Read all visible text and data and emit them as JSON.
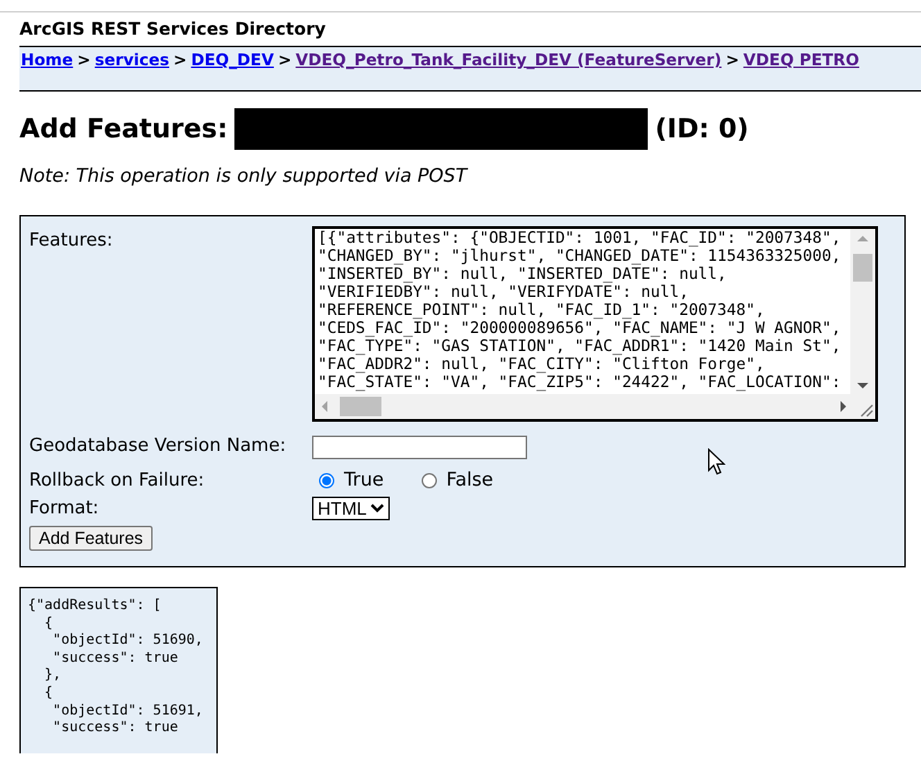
{
  "header": {
    "title": "ArcGIS REST Services Directory"
  },
  "breadcrumbs": [
    {
      "label": "Home",
      "visited": false
    },
    {
      "label": "services",
      "visited": false
    },
    {
      "label": "DEQ_DEV",
      "visited": false
    },
    {
      "label": "VDEQ_Petro_Tank_Facility_DEV (FeatureServer)",
      "visited": true
    },
    {
      "label": "VDEQ PETRO",
      "visited": true
    }
  ],
  "breadcrumb_separator": ">",
  "page_title": {
    "prefix": "Add Features:",
    "suffix": "(ID: 0)"
  },
  "note": "Note: This operation is only supported via POST",
  "form": {
    "features_label": "Features:",
    "features_lines": [
      "[{\"attributes\": {\"OBJECTID\": 1001, \"FAC_ID\": \"2007348\",",
      "\"CHANGED_BY\": \"jlhurst\", \"CHANGED_DATE\": 1154363325000,",
      "\"INSERTED_BY\": null, \"INSERTED_DATE\": null,",
      "\"VERIFIEDBY\": null, \"VERIFYDATE\": null,",
      "\"REFERENCE_POINT\": null, \"FAC_ID_1\": \"2007348\",",
      "\"CEDS_FAC_ID\": \"200000089656\", \"FAC_NAME\": \"J W AGNOR\",",
      "\"FAC_TYPE\": \"GAS STATION\", \"FAC_ADDR1\": \"1420 Main St\",",
      "\"FAC_ADDR2\": null, \"FAC_CITY\": \"Clifton Forge\",",
      "\"FAC_STATE\": \"VA\", \"FAC_ZIP5\": \"24422\", \"FAC_LOCATION\":"
    ],
    "version_label": "Geodatabase Version Name:",
    "rollback_label": "Rollback on Failure:",
    "rollback_options": [
      {
        "label": "True",
        "selected": true
      },
      {
        "label": "False",
        "selected": false
      }
    ],
    "format_label": "Format:",
    "format_value": "HTML",
    "submit": "Add Features"
  },
  "result_lines": [
    "{\"addResults\": [",
    "  {",
    "   \"objectId\": 51690,",
    "   \"success\": true",
    "  },",
    "  {",
    "   \"objectId\": 51691,",
    "   \"success\": true"
  ]
}
